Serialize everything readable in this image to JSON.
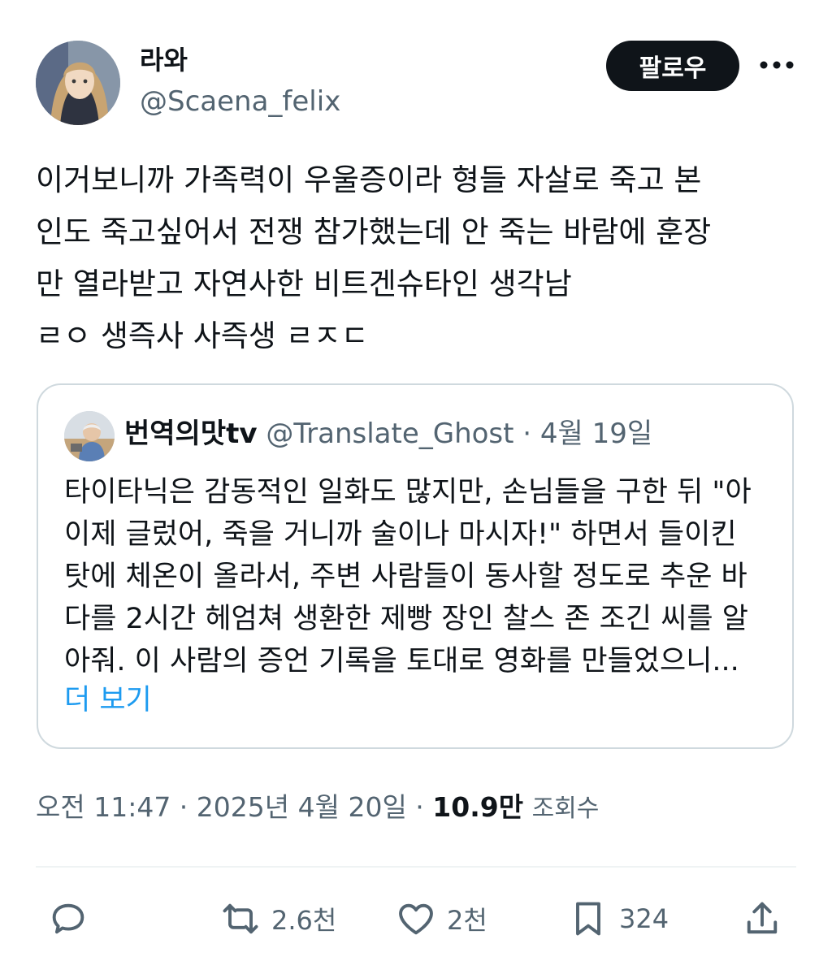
{
  "author": {
    "display_name": "라와",
    "handle": "@Scaena_felix",
    "avatar_icon": "anime-girl-avatar"
  },
  "follow_label": "팔로우",
  "more_icon": "more-horizontal-icon",
  "tweet_text": "이거보니까 가족력이 우울증이라 형들 자살로 죽고 본\n인도 죽고싶어서 전쟁 참가했는데 안 죽는 바람에 훈장\n만 열라받고 자연사한 비트겐슈타인 생각남\nㄹㅇ 생즉사 사즉생 ㄹㅈㄷ",
  "quote": {
    "display_name": "번역의맛tv",
    "handle": "@Translate_Ghost",
    "separator": "·",
    "date": "4월 19일",
    "avatar_icon": "elderly-man-avatar",
    "text": "타이타닉은 감동적인 일화도 많지만, 손님들을 구한 뒤 \"아\n이제 글렀어, 죽을 거니까 술이나 마시자!\" 하면서 들이킨\n탓에 체온이 올라서, 주변 사람들이 동사할 정도로 추운 바\n다를 2시간 헤엄쳐 생환한 제빵 장인 찰스 존 조긴 씨를 알\n아줘. 이 사람의 증언 기록을 토대로 영화를 만들었으니...",
    "show_more": "더 보기"
  },
  "meta": {
    "time_date": "오전 11:47 · 2025년 4월 20일 · ",
    "views_count": "10.9만",
    "views_label": "조회수"
  },
  "actions": {
    "reply_icon": "reply-bubble-icon",
    "retweet_count": "2.6천",
    "like_count": "2천",
    "bookmark_count": "324",
    "share_icon": "share-upload-icon"
  },
  "colors": {
    "text": "#0f1419",
    "secondary": "#536471",
    "link": "#1d9bf0",
    "border": "#cfd9de"
  }
}
